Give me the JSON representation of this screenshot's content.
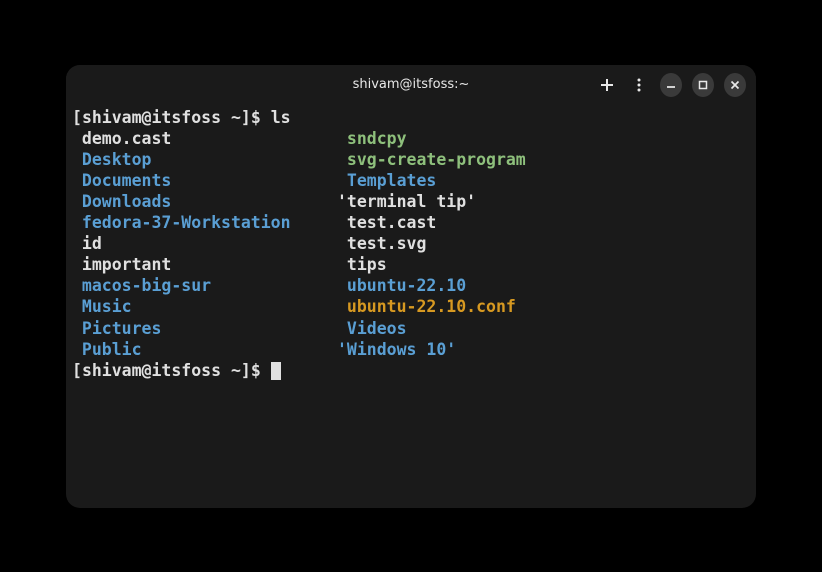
{
  "titlebar": {
    "title": "shivam@itsfoss:~"
  },
  "prompt": {
    "open": "[",
    "user_host": "shivam@itsfoss",
    "path": " ~",
    "close": "]$ "
  },
  "command": "ls",
  "listing": {
    "col1": [
      {
        "text": " demo.cast",
        "cls": "c-file"
      },
      {
        "text": " Desktop",
        "cls": "c-dir"
      },
      {
        "text": " Documents",
        "cls": "c-dir"
      },
      {
        "text": " Downloads",
        "cls": "c-dir"
      },
      {
        "text": " fedora-37-Workstation",
        "cls": "c-dir"
      },
      {
        "text": " id",
        "cls": "c-file"
      },
      {
        "text": " important",
        "cls": "c-file"
      },
      {
        "text": " macos-big-sur",
        "cls": "c-dir"
      },
      {
        "text": " Music",
        "cls": "c-dir"
      },
      {
        "text": " Pictures",
        "cls": "c-dir"
      },
      {
        "text": " Public",
        "cls": "c-dir"
      }
    ],
    "col2": [
      {
        "text": " sndcpy",
        "cls": "c-exec"
      },
      {
        "text": " svg-create-program",
        "cls": "c-exec"
      },
      {
        "text": " Templates",
        "cls": "c-dir"
      },
      {
        "text": "'terminal tip'",
        "cls": "c-file"
      },
      {
        "text": " test.cast",
        "cls": "c-file"
      },
      {
        "text": " test.svg",
        "cls": "c-file"
      },
      {
        "text": " tips",
        "cls": "c-file"
      },
      {
        "text": " ubuntu-22.10",
        "cls": "c-dir"
      },
      {
        "text": " ubuntu-22.10.conf",
        "cls": "c-conf"
      },
      {
        "text": " Videos",
        "cls": "c-dir"
      },
      {
        "text": "'Windows 10'",
        "cls": "c-dir"
      }
    ]
  }
}
